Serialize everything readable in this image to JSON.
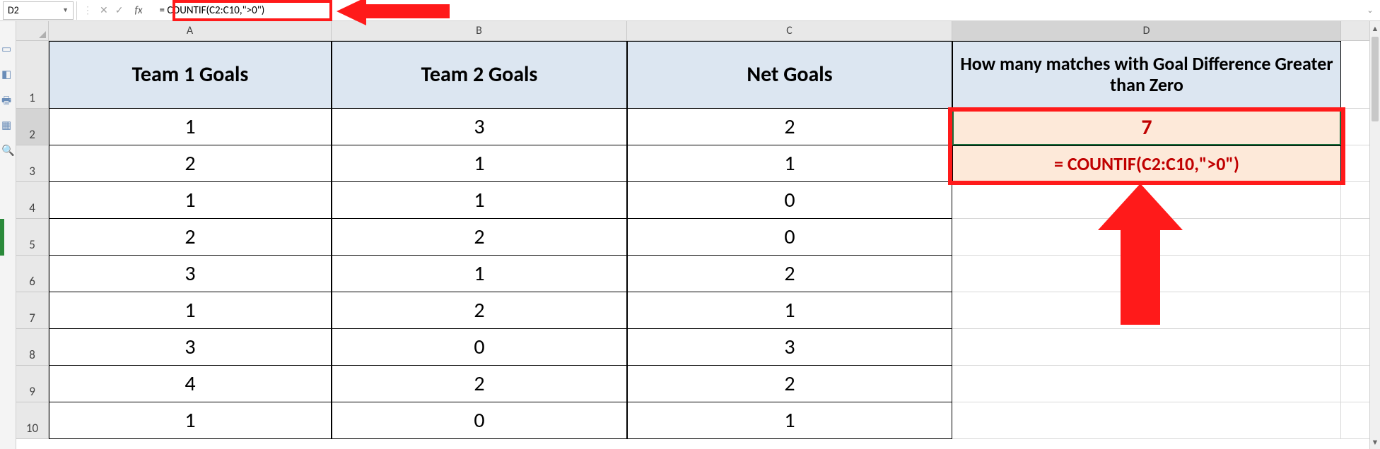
{
  "formula_bar": {
    "name_box": "D2",
    "fx_label": "fx",
    "formula": "= COUNTIF(C2:C10,\">0\")"
  },
  "columns": [
    "A",
    "B",
    "C",
    "D"
  ],
  "row_labels": [
    "1",
    "2",
    "3",
    "4",
    "5",
    "6",
    "7",
    "8",
    "9",
    "10"
  ],
  "headers": {
    "A": "Team 1 Goals",
    "B": "Team 2 Goals",
    "C": "Net Goals",
    "D": "How many matches with Goal Difference Greater than Zero"
  },
  "data_rows": [
    {
      "a": "1",
      "b": "3",
      "c": "2"
    },
    {
      "a": "2",
      "b": "1",
      "c": "1"
    },
    {
      "a": "1",
      "b": "1",
      "c": "0"
    },
    {
      "a": "2",
      "b": "2",
      "c": "0"
    },
    {
      "a": "3",
      "b": "1",
      "c": "2"
    },
    {
      "a": "1",
      "b": "2",
      "c": "1"
    },
    {
      "a": "3",
      "b": "0",
      "c": "3"
    },
    {
      "a": "4",
      "b": "2",
      "c": "2"
    },
    {
      "a": "1",
      "b": "0",
      "c": "1"
    }
  ],
  "d2_value": "7",
  "d3_value": "= COUNTIF(C2:C10,\">0\")",
  "selected_cell": "D2"
}
